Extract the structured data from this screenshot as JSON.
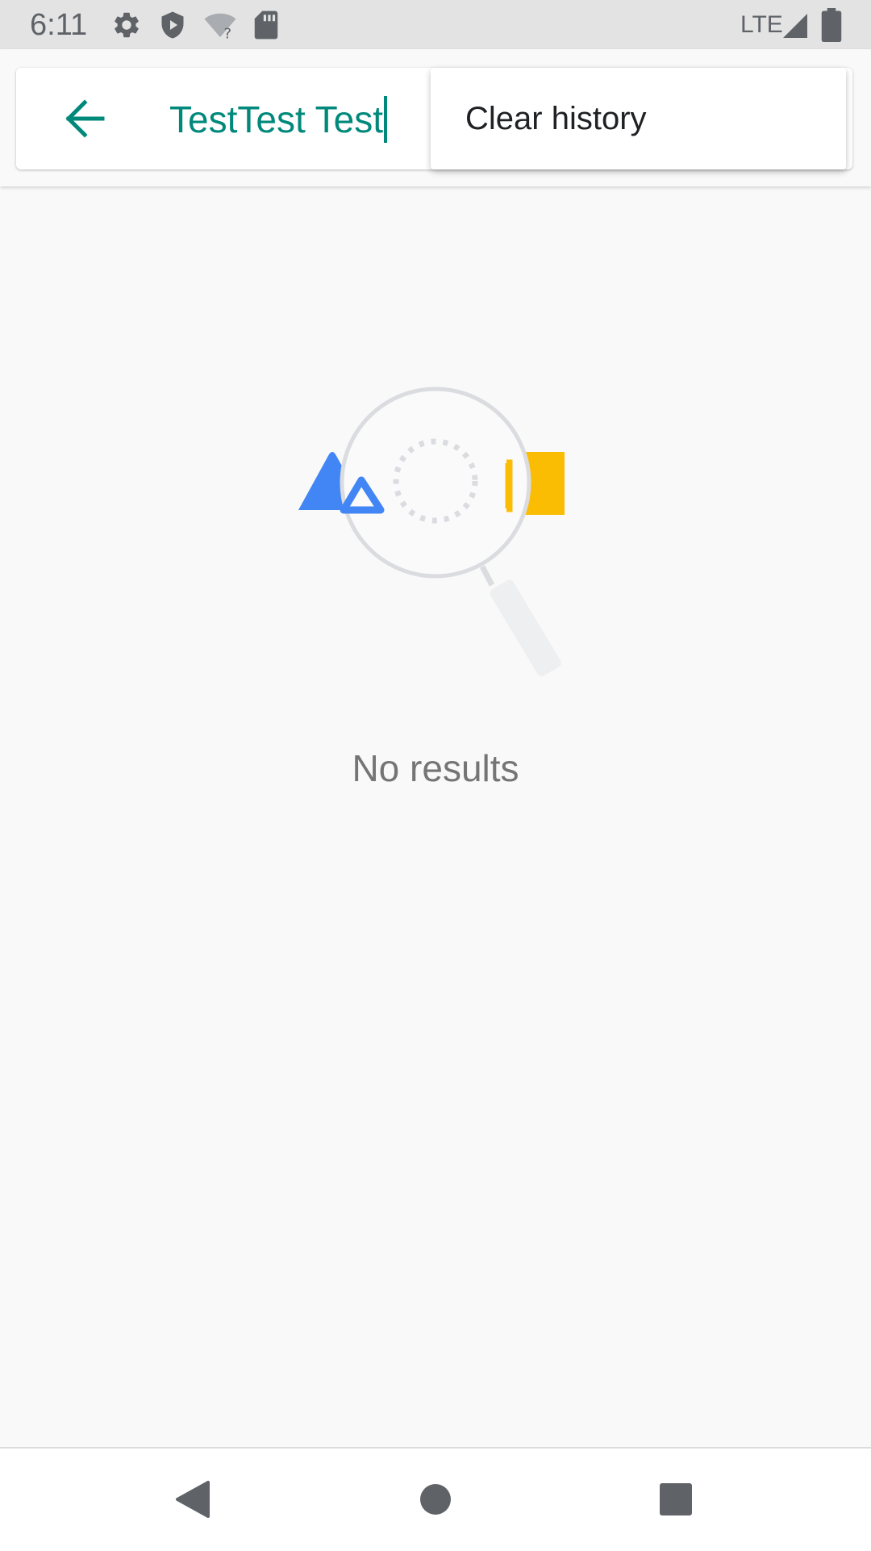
{
  "status_bar": {
    "time": "6:11",
    "network": "LTE",
    "icons": [
      "gear-icon",
      "shield-play-icon",
      "wifi-unknown-icon",
      "sd-card-icon",
      "cell-signal-icon",
      "battery-icon"
    ]
  },
  "search": {
    "query": "TestTest Test",
    "back_icon": "arrow-back-icon",
    "accent_color": "#00897b"
  },
  "overflow_menu": {
    "items": [
      {
        "label": "Clear history"
      }
    ]
  },
  "empty_state": {
    "message": "No results",
    "illustration_icon": "magnifier-no-results-icon",
    "colors": {
      "triangle": "#4285f4",
      "rectangle": "#fbbc04",
      "lens": "#dadce0"
    }
  },
  "navigation_bar": {
    "buttons": [
      "back-triangle-icon",
      "home-circle-icon",
      "recents-square-icon"
    ]
  }
}
